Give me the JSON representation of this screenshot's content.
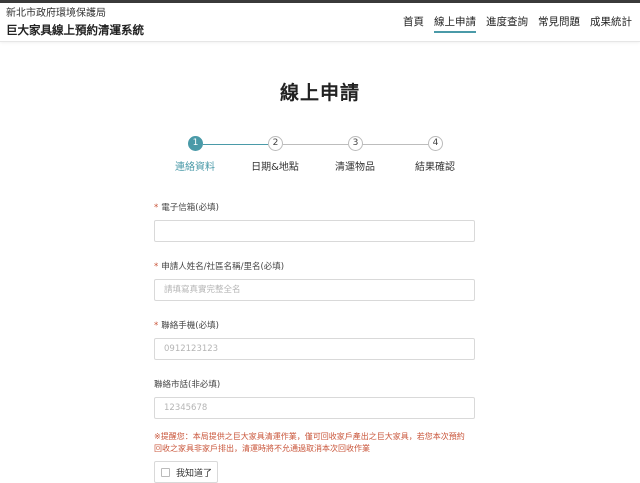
{
  "header": {
    "org": "新北市政府環境保護局",
    "system": "巨大家具線上預約清運系統"
  },
  "nav": {
    "items": [
      "首頁",
      "線上申請",
      "進度查詢",
      "常見問題",
      "成果統計"
    ],
    "active": "線上申請"
  },
  "page_title": "線上申請",
  "steps": [
    {
      "number": "1",
      "label": "連絡資料"
    },
    {
      "number": "2",
      "label": "日期&地點"
    },
    {
      "number": "3",
      "label": "清運物品"
    },
    {
      "number": "4",
      "label": "結果確認"
    }
  ],
  "form": {
    "email": {
      "label": "電子信箱(必填)",
      "value": "",
      "placeholder": ""
    },
    "name": {
      "label": "申請人姓名/社區名稱/里名(必填)",
      "value": "",
      "placeholder": "請填寫真實完整全名"
    },
    "mobile": {
      "label": "聯絡手機(必填)",
      "value": "",
      "placeholder": "0912123123"
    },
    "phone": {
      "label": "聯絡市話(非必填)",
      "value": "",
      "placeholder": "12345678"
    },
    "required_mark": "*"
  },
  "notice": {
    "line1": "※提醒您：本局提供之巨大家具清運作業，僅可回收家戶產出之巨大家具，若您本次預約",
    "line2": "回收之家具非家戶排出，清運時將不允通過取消本次回收作業"
  },
  "acknowledge": {
    "label": "我知道了",
    "checked": false
  },
  "colors": {
    "accent": "#4a9aa8",
    "required": "#c9553a"
  }
}
